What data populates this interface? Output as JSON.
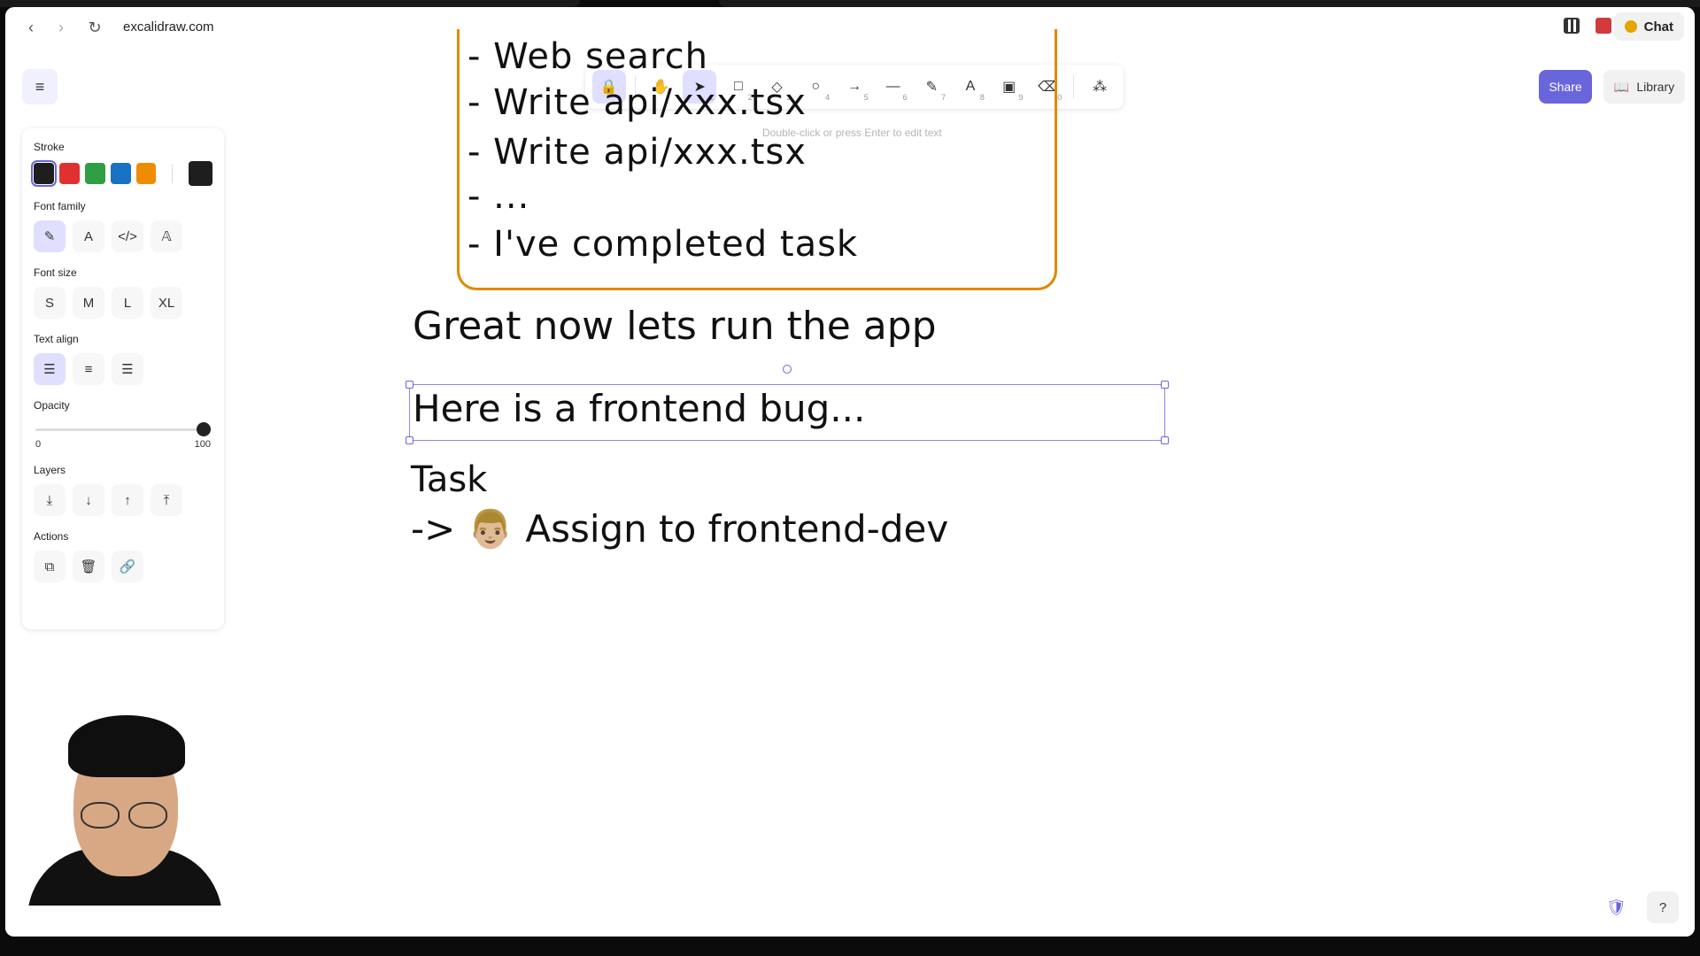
{
  "browser": {
    "url": "excalidraw.com",
    "chat_label": "Chat"
  },
  "toolbar": {
    "tools": [
      {
        "name": "lock",
        "icon": "lock-icon",
        "glyph": "🔒",
        "key": ""
      },
      {
        "name": "hand",
        "icon": "hand-icon",
        "glyph": "✋",
        "key": ""
      },
      {
        "name": "selection",
        "icon": "pointer-icon",
        "glyph": "➤",
        "key": "1"
      },
      {
        "name": "rectangle",
        "icon": "square-icon",
        "glyph": "□",
        "key": "2"
      },
      {
        "name": "diamond",
        "icon": "diamond-icon",
        "glyph": "◇",
        "key": "3"
      },
      {
        "name": "ellipse",
        "icon": "circle-icon",
        "glyph": "○",
        "key": "4"
      },
      {
        "name": "arrow",
        "icon": "arrow-icon",
        "glyph": "→",
        "key": "5"
      },
      {
        "name": "line",
        "icon": "line-icon",
        "glyph": "—",
        "key": "6"
      },
      {
        "name": "draw",
        "icon": "pencil-icon",
        "glyph": "✎",
        "key": "7"
      },
      {
        "name": "text",
        "icon": "text-icon",
        "glyph": "A",
        "key": "8"
      },
      {
        "name": "image",
        "icon": "image-icon",
        "glyph": "▣",
        "key": "9"
      },
      {
        "name": "eraser",
        "icon": "eraser-icon",
        "glyph": "⌫",
        "key": "0"
      },
      {
        "name": "extra",
        "icon": "shapes-icon",
        "glyph": "⁂",
        "key": ""
      }
    ],
    "hint": "Double-click or press Enter to edit text"
  },
  "actions": {
    "share": "Share",
    "library": "Library"
  },
  "panel": {
    "stroke_label": "Stroke",
    "stroke_colors": [
      "#1e1e1e",
      "#e03131",
      "#2f9e44",
      "#1971c2",
      "#f08c00"
    ],
    "stroke_current": "#1e1e1e",
    "font_family_label": "Font family",
    "font_size_label": "Font size",
    "font_sizes": [
      "S",
      "M",
      "L",
      "XL"
    ],
    "text_align_label": "Text align",
    "opacity_label": "Opacity",
    "opacity_min": "0",
    "opacity_max": "100",
    "opacity_value": 100,
    "layers_label": "Layers",
    "actions_label": "Actions"
  },
  "canvas": {
    "card_lines": [
      "- Web search",
      "- Write api/xxx.tsx",
      "- Write api/xxx.tsx",
      "- ...",
      "- I've completed task"
    ],
    "heading": "Great now lets run the app",
    "selected_text": "Here is a frontend bug...",
    "task_title": "Task",
    "task_assign": "-> 👨🏼 Assign to frontend-dev"
  },
  "colors": {
    "accent": "#6965db",
    "card_border": "#e08a00"
  }
}
